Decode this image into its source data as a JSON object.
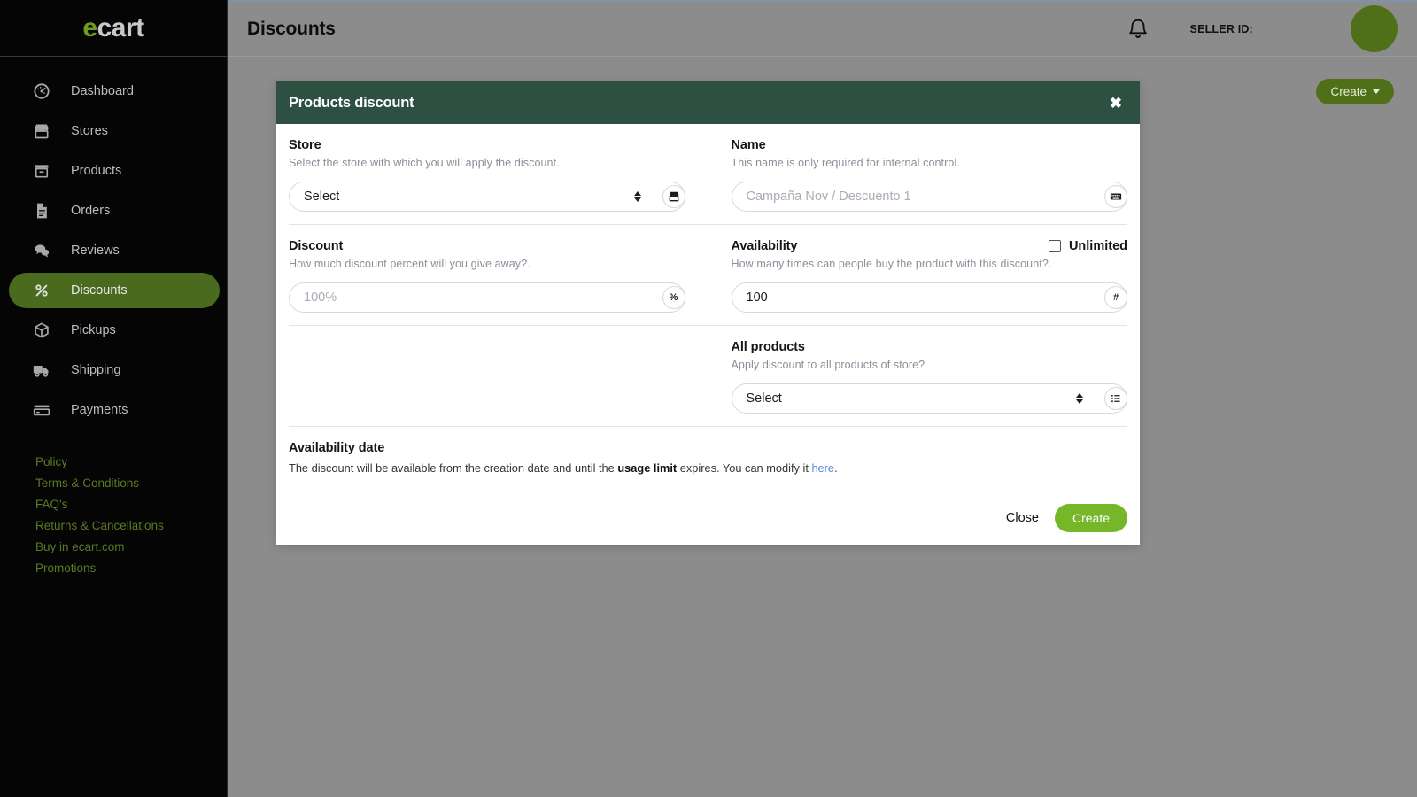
{
  "brand": {
    "prefix": "e",
    "rest": "cart"
  },
  "sidebar": {
    "items": [
      {
        "label": "Dashboard",
        "icon": "gauge-icon",
        "active": false
      },
      {
        "label": "Stores",
        "icon": "store-icon",
        "active": false
      },
      {
        "label": "Products",
        "icon": "box-archive-icon",
        "active": false
      },
      {
        "label": "Orders",
        "icon": "document-icon",
        "active": false
      },
      {
        "label": "Reviews",
        "icon": "chat-bubbles-icon",
        "active": false
      },
      {
        "label": "Discounts",
        "icon": "percent-icon",
        "active": true
      },
      {
        "label": "Pickups",
        "icon": "cube-icon",
        "active": false
      },
      {
        "label": "Shipping",
        "icon": "truck-icon",
        "active": false
      },
      {
        "label": "Payments",
        "icon": "credit-card-icon",
        "active": false
      }
    ],
    "footer_links": [
      "Policy",
      "Terms & Conditions",
      "FAQ's",
      "Returns & Cancellations",
      "Buy in ecart.com",
      "Promotions"
    ]
  },
  "topbar": {
    "page_title": "Discounts",
    "seller_id_label": "SELLER ID:",
    "bell_icon": "bell-icon"
  },
  "content": {
    "create_button": "Create"
  },
  "modal": {
    "title": "Products discount",
    "close_glyph": "✖",
    "fields": {
      "store": {
        "label": "Store",
        "hint": "Select the store with which you will apply the discount.",
        "value": "Select",
        "badge_icon": "store-icon",
        "is_placeholder": false
      },
      "name": {
        "label": "Name",
        "hint": "This name is only required for internal control.",
        "placeholder": "Campaña Nov / Descuento 1",
        "badge_icon": "keyboard-icon"
      },
      "discount": {
        "label": "Discount",
        "hint": "How much discount percent will you give away?.",
        "placeholder": "100%",
        "badge_icon": "percent-icon",
        "badge_glyph": "%"
      },
      "availability": {
        "label": "Availability",
        "hint": "How many times can people buy the product with this discount?.",
        "value": "100",
        "badge_icon": "hash-icon",
        "badge_glyph": "#",
        "checkbox_label": "Unlimited",
        "checkbox_checked": false
      },
      "all_products": {
        "label": "All products",
        "hint": "Apply discount to all products of store?",
        "value": "Select",
        "badge_icon": "list-icon"
      },
      "availability_date": {
        "label": "Availability date",
        "text_part1": "The discount will be available from the creation date and until the ",
        "text_bold": "usage limit",
        "text_part2": " expires. You can modify it ",
        "link_text": "here",
        "text_part3": "."
      }
    },
    "footer": {
      "close_label": "Close",
      "create_label": "Create"
    }
  },
  "colors": {
    "brand_green": "#6e9c1f",
    "sidebar_bg": "#050505",
    "sidebar_active": "#4a6b1e",
    "modal_header": "#2d5043",
    "modal_create": "#76b729",
    "topbar_bg": "#8c8c8c",
    "link_blue": "#5b86e5",
    "avatar": "#4f7019"
  }
}
